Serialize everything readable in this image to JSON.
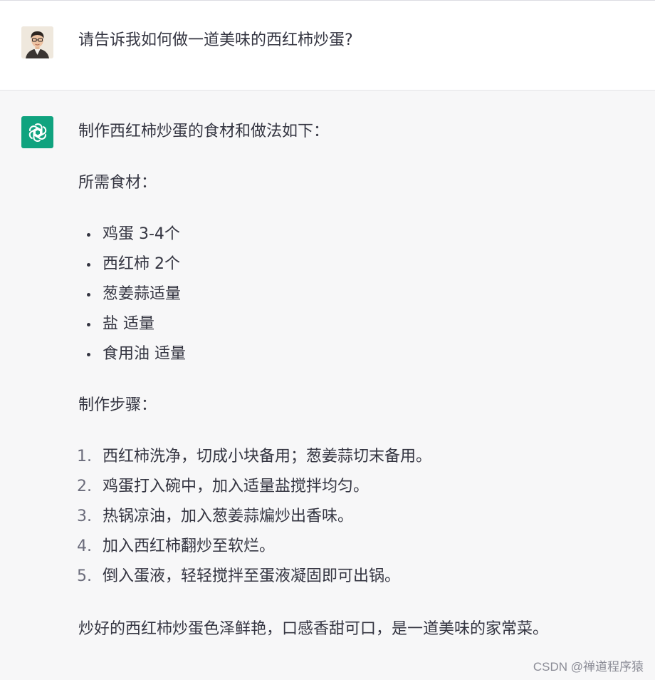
{
  "conversation": {
    "user_message": "请告诉我如何做一道美味的西红柿炒蛋?",
    "assistant": {
      "intro": "制作西红柿炒蛋的食材和做法如下：",
      "ingredients_heading": "所需食材：",
      "ingredients": [
        "鸡蛋 3-4个",
        "西红柿 2个",
        "葱姜蒜适量",
        "盐 适量",
        "食用油 适量"
      ],
      "steps_heading": "制作步骤：",
      "steps": [
        {
          "num": "1.",
          "text": "西红柿洗净，切成小块备用；葱姜蒜切末备用。"
        },
        {
          "num": "2.",
          "text": "鸡蛋打入碗中，加入适量盐搅拌均匀。"
        },
        {
          "num": "3.",
          "text": "热锅凉油，加入葱姜蒜煸炒出香味。"
        },
        {
          "num": "4.",
          "text": "加入西红柿翻炒至软烂。"
        },
        {
          "num": "5.",
          "text": "倒入蛋液，轻轻搅拌至蛋液凝固即可出锅。"
        }
      ],
      "conclusion": "炒好的西红柿炒蛋色泽鲜艳，口感香甜可口，是一道美味的家常菜。"
    }
  },
  "watermark": "CSDN @禅道程序猿",
  "colors": {
    "user_bg": "#ffffff",
    "assistant_bg": "#f7f7f8",
    "text": "#343541",
    "gpt_green": "#10a37f"
  },
  "icons": {
    "user_avatar": "user-avatar-photo",
    "assistant_avatar": "openai-logo-icon"
  }
}
